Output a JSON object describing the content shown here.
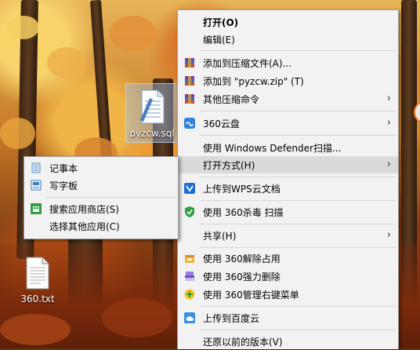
{
  "desktop": {
    "icons": [
      {
        "label": "pyzcw.sql"
      },
      {
        "label": "360.txt"
      }
    ]
  },
  "context_menu": {
    "items": [
      {
        "label": "打开(O)",
        "icon": "none",
        "bold": true
      },
      {
        "label": "编辑(E)",
        "icon": "none"
      },
      {
        "label": "添加到压缩文件(A)...",
        "icon": "winrar-icon"
      },
      {
        "label": "添加到 \"pyzcw.zip\" (T)",
        "icon": "winrar-icon"
      },
      {
        "label": "其他压缩命令",
        "icon": "winrar-icon",
        "submenu": true
      },
      {
        "label": "360云盘",
        "icon": "360-cloud-icon",
        "submenu": true
      },
      {
        "label": "使用 Windows Defender扫描...",
        "icon": "none"
      },
      {
        "label": "打开方式(H)",
        "icon": "none",
        "submenu": true,
        "highlighted": true
      },
      {
        "label": "上传到WPS云文档",
        "icon": "wps-cloud-icon"
      },
      {
        "label": "使用 360杀毒 扫描",
        "icon": "360-antivirus-icon"
      },
      {
        "label": "共享(H)",
        "icon": "none",
        "submenu": true
      },
      {
        "label": "使用 360解除占用",
        "icon": "360-unlock-icon"
      },
      {
        "label": "使用 360强力删除",
        "icon": "360-shred-icon"
      },
      {
        "label": "使用 360管理右键菜单",
        "icon": "360-manage-icon"
      },
      {
        "label": "上传到百度云",
        "icon": "baidu-cloud-icon"
      },
      {
        "label": "还原以前的版本(V)",
        "icon": "none"
      }
    ],
    "arrow": "›"
  },
  "open_with_submenu": {
    "items": [
      {
        "label": "记事本",
        "icon": "notepad-icon"
      },
      {
        "label": "写字板",
        "icon": "wordpad-icon"
      },
      {
        "label": "搜索应用商店(S)",
        "icon": "store-icon"
      },
      {
        "label": "选择其他应用(C)",
        "icon": "none"
      }
    ]
  }
}
